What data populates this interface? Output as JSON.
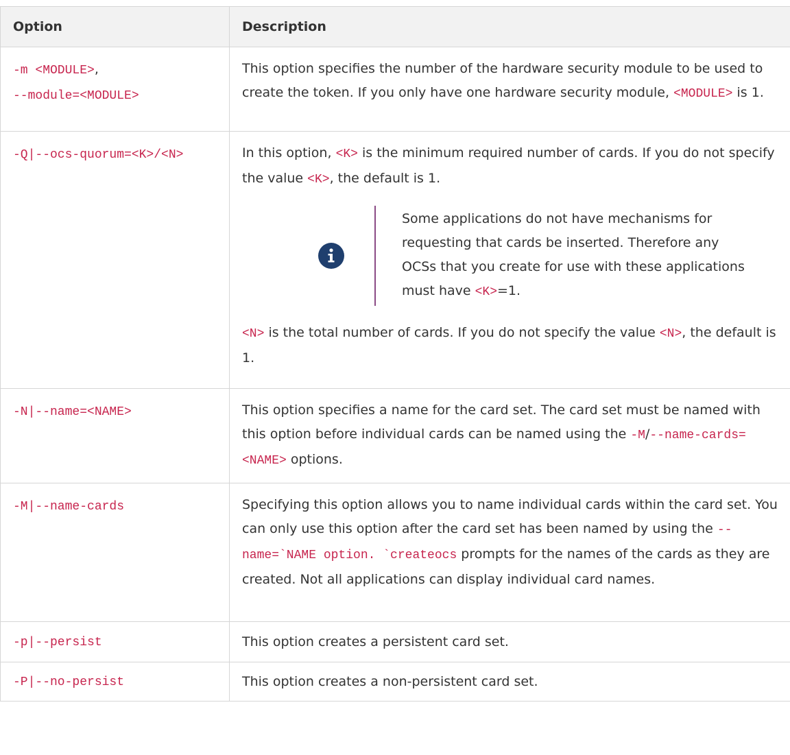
{
  "table": {
    "headers": {
      "option": "Option",
      "description": "Description"
    },
    "rows": [
      {
        "option_lines": [
          "-m <MODULE>",
          "--module=<MODULE>"
        ],
        "desc": {
          "t1": "This option specifies the number of the hardware security module to be used to create the token. If you only have one hardware security module, ",
          "c1": "<MODULE>",
          "t2": " is 1."
        }
      },
      {
        "option": "-Q|--ocs-quorum=<K>/<N>",
        "desc": {
          "p1a": "In this option, ",
          "p1c1": "<K>",
          "p1b": " is the minimum required number of cards. If you do not specify the value ",
          "p1c2": "<K>",
          "p1d": ", the default is 1.",
          "note_a": "Some applications do not have mechanisms for requesting that cards be inserted. Therefore any OCSs that you create for use with these applications must have ",
          "note_c": "<K>",
          "note_b": "=1.",
          "p2c1": "<N>",
          "p2a": " is the total number of cards. If you do not specify the value ",
          "p2c2": "<N>",
          "p2b": ", the default is 1."
        }
      },
      {
        "option": "-N|--name=<NAME>",
        "desc": {
          "t1": "This option specifies a name for the card set. The card set must be named with this option before individual cards can be named using the ",
          "c1": "-M",
          "sep": "/",
          "c2": "--name-cards=<NAME>",
          "t2": " options."
        }
      },
      {
        "option": "-M|--name-cards",
        "desc": {
          "t1": "Specifying this option allows you to name individual cards within the card set. You can only use this option after the card set has been named by using the ",
          "c1": "--name=`NAME option. `createocs",
          "t2": " prompts for the names of the cards as they are created. Not all applications can display individual card names."
        }
      },
      {
        "option": "-p|--persist",
        "desc": {
          "t1": "This option creates a persistent card set."
        }
      },
      {
        "option": "-P|--no-persist",
        "desc": {
          "t1": "This option creates a non-persistent card set."
        }
      }
    ]
  },
  "icons": {
    "note": "info-icon"
  },
  "colors": {
    "code": "#c7254e",
    "icon_bg": "#1f3f6e",
    "note_border": "#8a4a84",
    "header_bg": "#f2f2f2"
  }
}
